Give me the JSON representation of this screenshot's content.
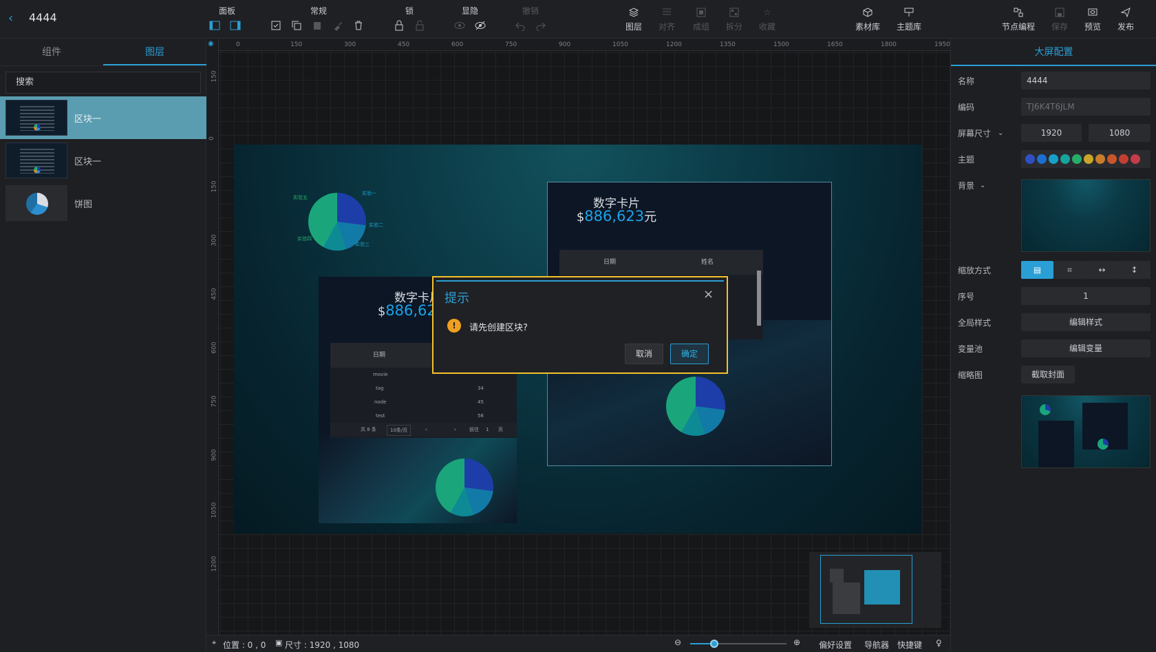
{
  "app": {
    "title": "4444"
  },
  "toolbar": {
    "groups": {
      "panel": "面板",
      "common": "常规",
      "lock": "锁",
      "visibility": "显隐",
      "undo": "撤销"
    },
    "layer": "图层",
    "align": "对齐",
    "group": "成组",
    "split": "拆分",
    "favorite": "收藏",
    "assets": "素材库",
    "theme": "主题库",
    "node_prog": "节点编程",
    "save": "保存",
    "preview": "预览",
    "publish": "发布"
  },
  "left_panel": {
    "tabs": [
      "组件",
      "图层"
    ],
    "active_tab": "图层",
    "search_placeholder": "搜索",
    "layers": [
      {
        "name": "区块一",
        "selected": true
      },
      {
        "name": "区块一",
        "selected": false
      },
      {
        "name": "饼图",
        "selected": false
      }
    ]
  },
  "ruler": {
    "h_ticks": [
      "0",
      "150",
      "300",
      "450",
      "600",
      "750",
      "900",
      "1050",
      "1200",
      "1350",
      "1500",
      "1650",
      "1800",
      "1950"
    ],
    "v_ticks": [
      "150",
      "0",
      "150",
      "300",
      "450",
      "600",
      "750",
      "900",
      "1050",
      "1200"
    ]
  },
  "canvas": {
    "card1": {
      "title": "数字卡片",
      "prefix": "$",
      "value": "886,623",
      "suffix": "元",
      "col1": "日期",
      "col2": "姓名",
      "rows": [
        [
          "movie",
          ""
        ],
        [
          "tag",
          "34"
        ],
        [
          "node",
          "45"
        ],
        [
          "test",
          "56"
        ]
      ],
      "pager": {
        "total": "共 8 条",
        "size": "10条/页",
        "prev": "‹",
        "next": "›",
        "goto": "前往",
        "page": "1",
        "unit": "页"
      }
    },
    "card2": {
      "title": "数字卡片",
      "prefix": "$",
      "value": "886,623",
      "suffix": "元",
      "col1": "日期",
      "col2": "姓名"
    },
    "pie_labels": [
      "实验五",
      "实验四",
      "实验三",
      "实验二",
      "实验一"
    ]
  },
  "modal": {
    "title": "提示",
    "message": "请先创建区块?",
    "cancel": "取消",
    "ok": "确定",
    "close": "×",
    "warn": "!"
  },
  "right_panel": {
    "title": "大屏配置",
    "name_label": "名称",
    "name_value": "4444",
    "code_label": "编码",
    "code_value": "TJ6K4T6JLM",
    "size_label": "屏幕尺寸",
    "width": "1920",
    "height": "1080",
    "theme_label": "主题",
    "theme_colors": [
      "#2f4fc2",
      "#1c6fd1",
      "#1aa0c8",
      "#17a49b",
      "#27ad6a",
      "#c9a52a",
      "#c97c2a",
      "#c9562a",
      "#c23f34",
      "#c43c49"
    ],
    "bg_label": "背景",
    "scale_label": "缩放方式",
    "order_label": "序号",
    "order_value": "1",
    "global_style_label": "全局样式",
    "global_style_btn": "编辑样式",
    "var_label": "变量池",
    "var_btn": "编辑变量",
    "thumb_label": "缩略图",
    "thumb_btn": "截取封面"
  },
  "status": {
    "position": "位置 : 0 , 0",
    "size": "尺寸 : 1920 , 1080",
    "pref": "偏好设置",
    "nav": "导航器",
    "shortcut": "快捷键",
    "zoom_percent": 25
  }
}
